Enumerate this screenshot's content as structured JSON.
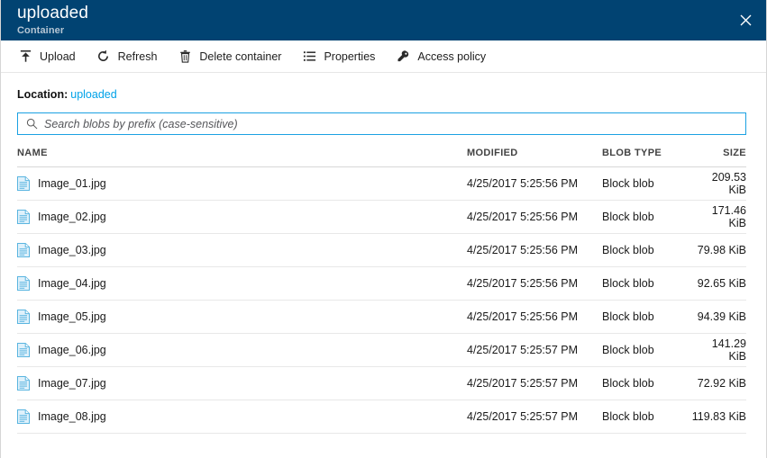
{
  "header": {
    "title": "uploaded",
    "subtitle": "Container",
    "close_label": "✕",
    "background_color": "#014372"
  },
  "toolbar": {
    "items": [
      {
        "label": "Upload",
        "icon": "upload-icon"
      },
      {
        "label": "Refresh",
        "icon": "refresh-icon"
      },
      {
        "label": "Delete container",
        "icon": "trash-icon"
      },
      {
        "label": "Properties",
        "icon": "list-icon"
      },
      {
        "label": "Access policy",
        "icon": "key-icon"
      }
    ]
  },
  "location": {
    "label": "Location:",
    "value": "uploaded",
    "link_color": "#00a2e8"
  },
  "search": {
    "placeholder": "Search blobs by prefix (case-sensitive)",
    "value": "",
    "border_color": "#1ba1e2",
    "icon": "search-icon"
  },
  "table": {
    "columns": [
      "NAME",
      "MODIFIED",
      "BLOB TYPE",
      "SIZE"
    ],
    "rows": [
      {
        "name": "Image_01.jpg",
        "modified": "4/25/2017 5:25:56 PM",
        "blob_type": "Block blob",
        "size": "209.53 KiB"
      },
      {
        "name": "Image_02.jpg",
        "modified": "4/25/2017 5:25:56 PM",
        "blob_type": "Block blob",
        "size": "171.46 KiB"
      },
      {
        "name": "Image_03.jpg",
        "modified": "4/25/2017 5:25:56 PM",
        "blob_type": "Block blob",
        "size": "79.98 KiB"
      },
      {
        "name": "Image_04.jpg",
        "modified": "4/25/2017 5:25:56 PM",
        "blob_type": "Block blob",
        "size": "92.65 KiB"
      },
      {
        "name": "Image_05.jpg",
        "modified": "4/25/2017 5:25:56 PM",
        "blob_type": "Block blob",
        "size": "94.39 KiB"
      },
      {
        "name": "Image_06.jpg",
        "modified": "4/25/2017 5:25:57 PM",
        "blob_type": "Block blob",
        "size": "141.29 KiB"
      },
      {
        "name": "Image_07.jpg",
        "modified": "4/25/2017 5:25:57 PM",
        "blob_type": "Block blob",
        "size": "72.92 KiB"
      },
      {
        "name": "Image_08.jpg",
        "modified": "4/25/2017 5:25:57 PM",
        "blob_type": "Block blob",
        "size": "119.83 KiB"
      }
    ],
    "row_icon": "file-icon"
  }
}
